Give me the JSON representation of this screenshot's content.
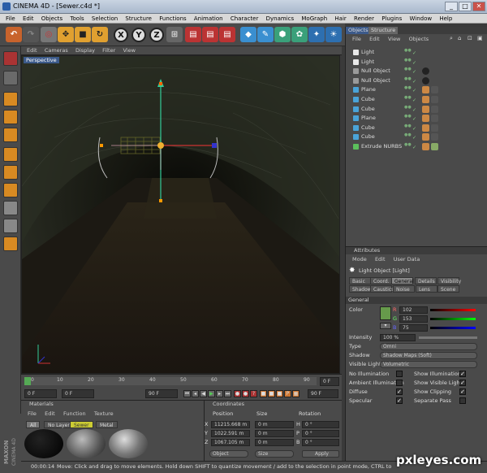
{
  "window": {
    "title": "CINEMA 4D - [Sewer.c4d *]",
    "min": "_",
    "max": "□",
    "close": "✕"
  },
  "menu": [
    "File",
    "Edit",
    "Objects",
    "Tools",
    "Selection",
    "Structure",
    "Functions",
    "Animation",
    "Character",
    "Dynamics",
    "MoGraph",
    "Hair",
    "Render",
    "Plugins",
    "Window",
    "Help"
  ],
  "toolbar": {
    "x": "X",
    "y": "Y",
    "z": "Z"
  },
  "viewport": {
    "menu": [
      "Edit",
      "Cameras",
      "Display",
      "Filter",
      "View"
    ],
    "label": "Perspective"
  },
  "timeline": {
    "ticks": [
      "0",
      "10",
      "20",
      "30",
      "40",
      "50",
      "60",
      "70",
      "80",
      "90"
    ],
    "current_frame": "0 F",
    "start_frame": "0 F",
    "end_frame": "90 F",
    "end_frame_right": "90 F",
    "right_field": "0 F"
  },
  "materials": {
    "title": "Materials",
    "menu": [
      "File",
      "Edit",
      "Function",
      "Texture"
    ],
    "filters": [
      "All",
      "No Layer",
      "Sewer",
      "Metal"
    ]
  },
  "coordinates": {
    "title": "Coordinates",
    "headers": [
      "Position",
      "Size",
      "Rotation"
    ],
    "rows": [
      {
        "axis": "X",
        "pos": "11215.668 m",
        "size": "0 m",
        "rot_axis": "H",
        "rot": "0 °"
      },
      {
        "axis": "Y",
        "pos": "1022.591 m",
        "size": "0 m",
        "rot_axis": "P",
        "rot": "0 °"
      },
      {
        "axis": "Z",
        "pos": "1067.105 m",
        "size": "0 m",
        "rot_axis": "B",
        "rot": "0 °"
      }
    ],
    "mode": "Object",
    "size_mode": "Size",
    "apply": "Apply"
  },
  "objects": {
    "tabs": [
      "Objects",
      "Structure"
    ],
    "menu": [
      "File",
      "Edit",
      "View",
      "Objects"
    ],
    "items": [
      {
        "name": "Light",
        "color": "#e8e8e8"
      },
      {
        "name": "Light",
        "color": "#e8e8e8"
      },
      {
        "name": "Null Object",
        "color": "#9a9a9a"
      },
      {
        "name": "Null Object",
        "color": "#9a9a9a"
      },
      {
        "name": "Plane",
        "color": "#4aa3d8"
      },
      {
        "name": "Cube",
        "color": "#4aa3d8"
      },
      {
        "name": "Cube",
        "color": "#4aa3d8"
      },
      {
        "name": "Plane",
        "color": "#4aa3d8"
      },
      {
        "name": "Cube",
        "color": "#4aa3d8"
      },
      {
        "name": "Cube",
        "color": "#4aa3d8"
      },
      {
        "name": "Extrude NURBS",
        "color": "#5cc05c"
      }
    ]
  },
  "attributes": {
    "title": "Attributes",
    "menu": [
      "Mode",
      "Edit",
      "User Data"
    ],
    "object": "Light Object [Light]",
    "tabs_row1": [
      "Basic",
      "Coord.",
      "General",
      "Details",
      "Visibility"
    ],
    "tabs_row2": [
      "Shadow",
      "Caustics",
      "Noise",
      "Lens",
      "Scene"
    ],
    "section": "General",
    "color_label": "Color",
    "r": "102",
    "g": "153",
    "b": "75",
    "intensity_label": "Intensity",
    "intensity": "100 %",
    "type_label": "Type",
    "type": "Omni",
    "shadow_label": "Shadow",
    "shadow": "Shadow Maps (Soft)",
    "visible_label": "Visible Light",
    "visible": "Volumetric",
    "checks_left": [
      "No Illumination",
      "Ambient Illumination",
      "Diffuse",
      "Specular"
    ],
    "checks_right": [
      "Show Illumination",
      "Show Visible Light",
      "Show Clipping",
      "Separate Pass"
    ]
  },
  "status": {
    "time": "00:00:14",
    "message": "Move: Click and drag to move elements. Hold down SHIFT to quantize movement / add to the selection in point mode, CTRL to"
  },
  "branding": {
    "maxon": "MAXON",
    "c4d": "CINEMA 4D"
  },
  "watermark": "pxleyes.com",
  "colors": {
    "accent": "#3c5a8a",
    "light_color": "#669a4b"
  }
}
